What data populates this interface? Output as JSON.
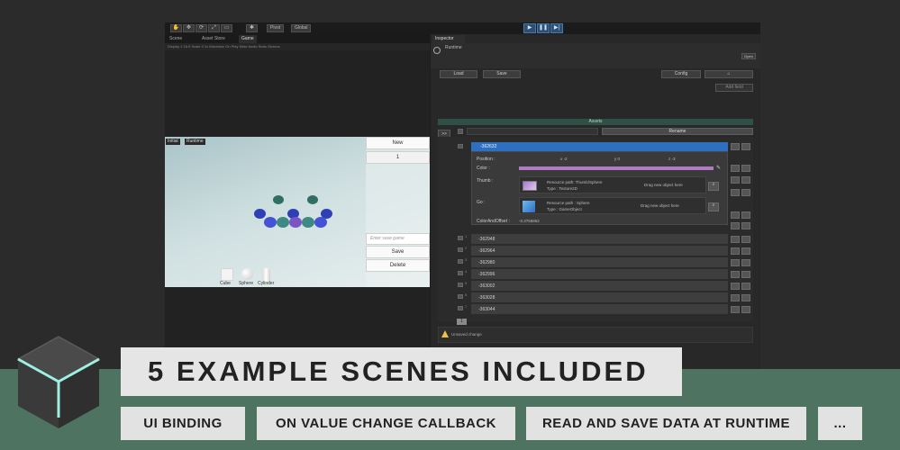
{
  "toolbar": {
    "tools": [
      "✋",
      "✥",
      "⟳",
      "⤢",
      "▭",
      "✱"
    ],
    "pivot": "Pivot",
    "global": "Global",
    "play": "▶",
    "pause": "❚❚",
    "step": "▶|"
  },
  "game": {
    "tabs": [
      "Scene",
      "Asset Store",
      "Game"
    ],
    "bar_text": "Display 1    16:9                          Scale 0        1x         Maximize On Play   Mute Audio   Stats   Gizmos",
    "labels": [
      "Initial",
      "Runtime"
    ],
    "ui": {
      "new_label": "New",
      "count_value": "1",
      "save_placeholder": "Enter save game",
      "save_label": "Save",
      "delete_label": "Delete"
    },
    "primitives": [
      "Cube",
      "Sphere",
      "Cylinder"
    ]
  },
  "inspector": {
    "tab": "Inspector",
    "object_name": "Runtime",
    "top_right_labels": [
      "Open"
    ],
    "buttons": [
      "Load",
      "Save",
      "Config",
      "⌂"
    ],
    "add_field": "Add field",
    "assets_label": "Assets",
    "rename_label": "Rename",
    "expand_label": ">>",
    "selected_item": "-362632",
    "fields": {
      "position_label": "Position :",
      "position_values": [
        "x  -2",
        "y  0",
        "z  -3"
      ],
      "color_label": "Color :",
      "thumb_label": "Thumb :",
      "thumb_path": "Resource path: Thumb/Sphere",
      "thumb_type": "Type : Texture2D",
      "drag_hint": "Drag new object here",
      "go_label": "Go :",
      "go_path": "Resource path : Sphere",
      "go_type": "Type : GameObject",
      "offset_label": "ColorAndOffset :",
      "offset_value": "-0.3756862"
    },
    "rows": [
      "-362948",
      "-362964",
      "-362980",
      "-362996",
      "-363002",
      "-363028",
      "-363044"
    ],
    "row_indices": [
      "1",
      "2",
      "3",
      "4",
      "5",
      "6",
      "7"
    ],
    "page": "1",
    "warning": "Unsaved change"
  },
  "banner": {
    "title": "5 EXAMPLE SCENES INCLUDED"
  },
  "tags": [
    "UI BINDING",
    "ON VALUE CHANGE CALLBACK",
    "READ AND SAVE DATA AT RUNTIME",
    "..."
  ],
  "colors": {
    "band": "#4f7361",
    "banner": "#e5e5e5",
    "selection": "#2e6fc0",
    "accent": "#b07ac7"
  }
}
